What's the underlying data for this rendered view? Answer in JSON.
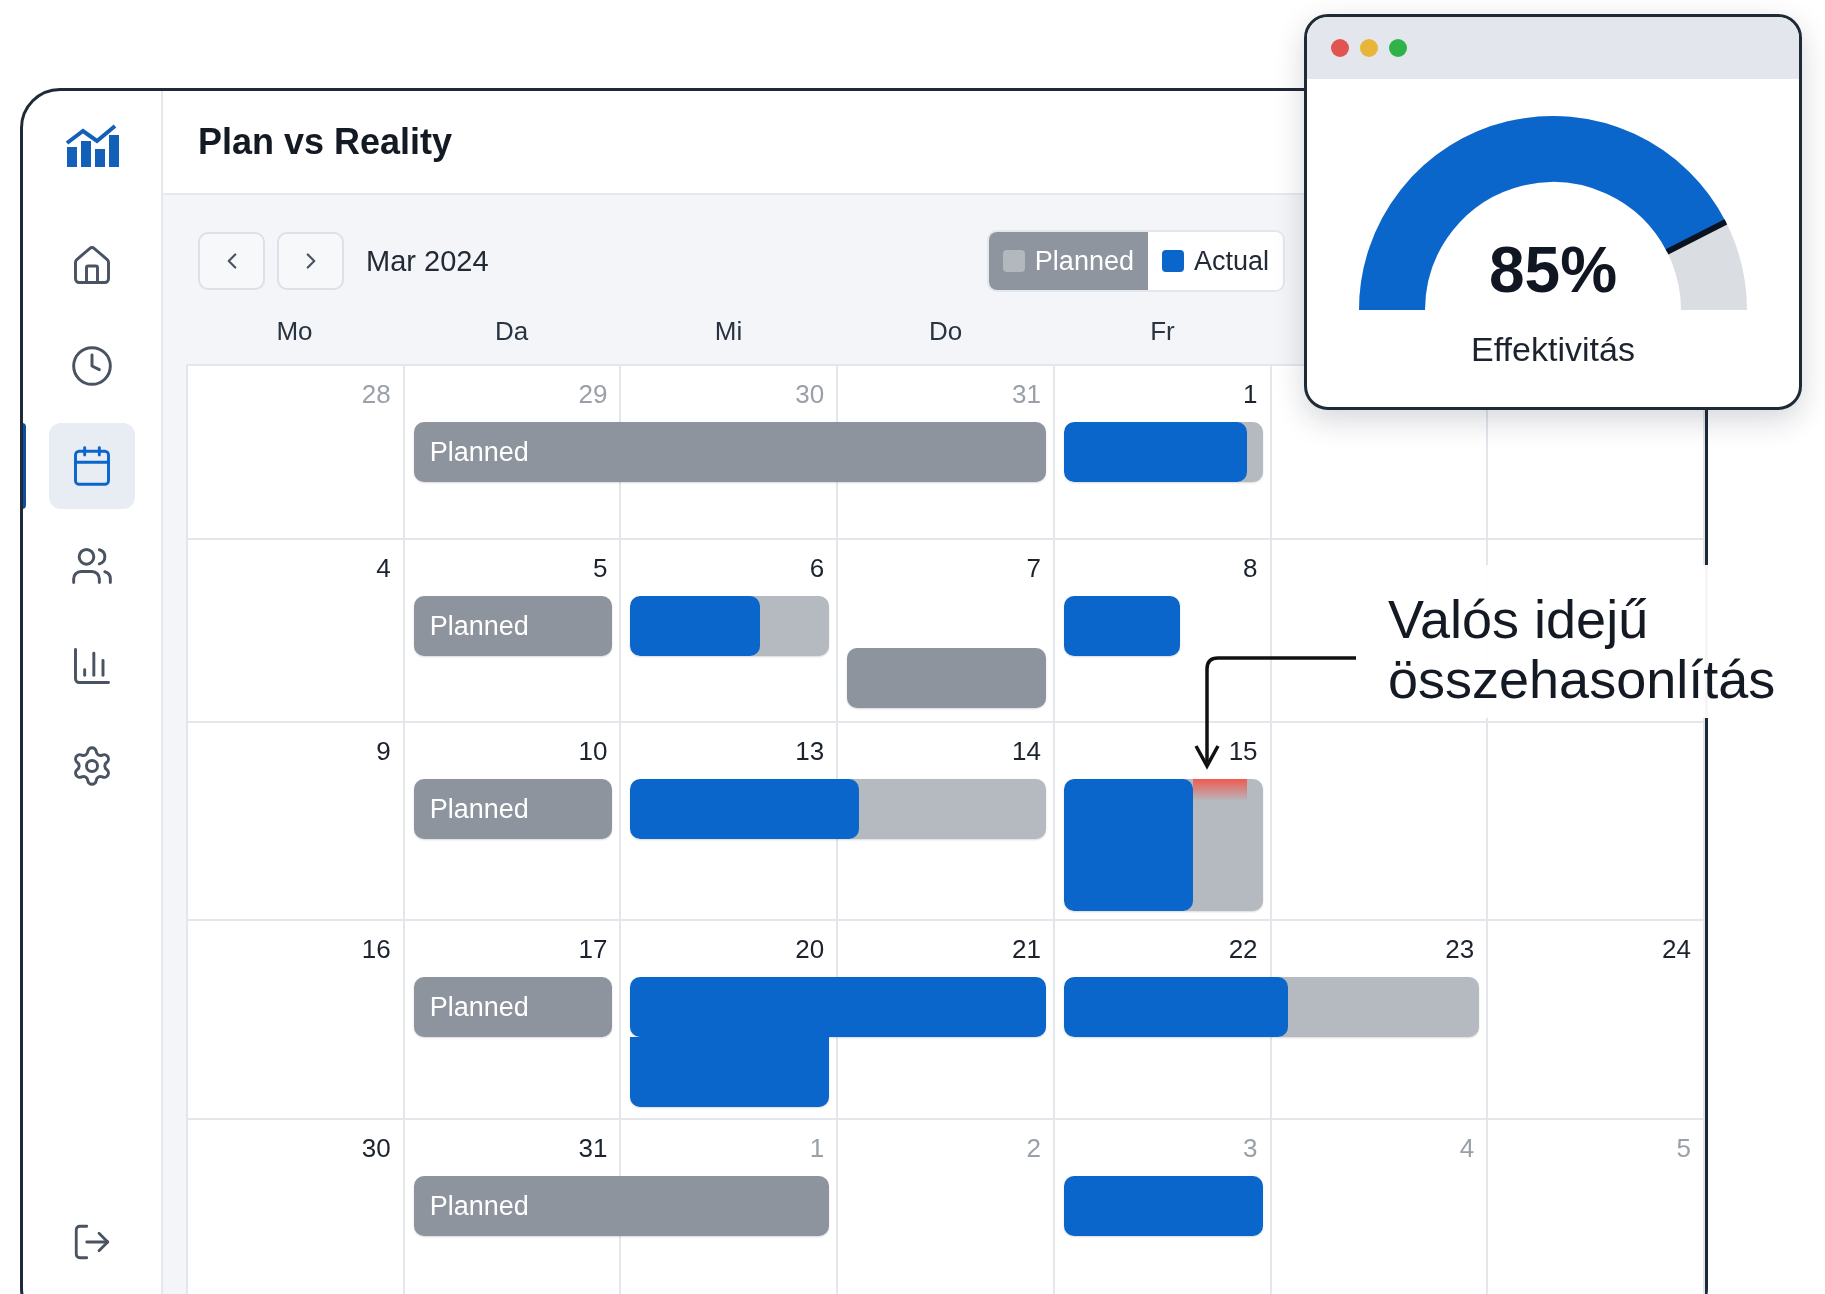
{
  "sidebar": {
    "items": [
      {
        "kind": "home",
        "selected": false
      },
      {
        "kind": "clock",
        "selected": false
      },
      {
        "kind": "calendar",
        "selected": true
      },
      {
        "kind": "users",
        "selected": false
      },
      {
        "kind": "report",
        "selected": false
      },
      {
        "kind": "settings",
        "selected": false
      }
    ]
  },
  "header": {
    "title": "Plan vs Reality"
  },
  "toolbar": {
    "month": "Mar 2024",
    "legend": [
      {
        "kind": "planned",
        "label": "Planned",
        "selected": true
      },
      {
        "kind": "actual",
        "label": "Actual",
        "selected": false
      }
    ]
  },
  "weekdays": [
    "Mo",
    "Da",
    "Mi",
    "Do",
    "Fr"
  ],
  "weeks": [
    {
      "days": [
        {
          "text": "28",
          "muted": true
        },
        {
          "text": "29",
          "muted": true
        },
        {
          "text": "30",
          "muted": true
        },
        {
          "text": "31",
          "muted": true
        },
        {
          "text": "1",
          "muted": false
        }
      ],
      "bars": [
        {
          "kind": "planned",
          "label": "Planned"
        },
        {
          "kind": "progress",
          "level": 0.92
        }
      ]
    },
    {
      "days": [
        {
          "text": "4",
          "muted": false
        },
        {
          "text": "5",
          "muted": false
        },
        {
          "text": "6",
          "muted": false
        },
        {
          "text": "7",
          "muted": false
        },
        {
          "text": "8",
          "muted": false
        }
      ],
      "bars": [
        {
          "kind": "planned",
          "label": "Planned"
        },
        {
          "kind": "progress",
          "level": 0.65
        },
        {
          "kind": "planned"
        },
        {
          "kind": "actual"
        }
      ]
    },
    {
      "days": [
        {
          "text": "9",
          "muted": false
        },
        {
          "text": "10",
          "muted": false
        },
        {
          "text": "13",
          "muted": false
        },
        {
          "text": "14",
          "muted": false
        },
        {
          "text": "15",
          "muted": false
        }
      ],
      "bars": [
        {
          "kind": "planned",
          "label": "Planned"
        },
        {
          "kind": "progress",
          "level": 0.55
        },
        {
          "kind": "progress",
          "level": 0.65,
          "overrun": true
        }
      ]
    },
    {
      "days": [
        {
          "text": "16",
          "muted": false
        },
        {
          "text": "17",
          "muted": false
        },
        {
          "text": "20",
          "muted": false
        },
        {
          "text": "21",
          "muted": false
        },
        {
          "text": "22",
          "muted": false
        },
        {
          "text": "23",
          "muted": false
        },
        {
          "text": "24",
          "muted": false
        }
      ],
      "bars": [
        {
          "kind": "planned",
          "label": "Planned"
        },
        {
          "kind": "actual"
        },
        {
          "kind": "actual"
        },
        {
          "kind": "progress",
          "level": 0.54
        }
      ]
    },
    {
      "days": [
        {
          "text": "30",
          "muted": false
        },
        {
          "text": "31",
          "muted": false
        },
        {
          "text": "1",
          "muted": true
        },
        {
          "text": "2",
          "muted": true
        },
        {
          "text": "3",
          "muted": true
        },
        {
          "text": "4",
          "muted": true
        },
        {
          "text": "5",
          "muted": true
        }
      ],
      "bars": [
        {
          "kind": "planned",
          "label": "Planned"
        },
        {
          "kind": "actual"
        }
      ]
    }
  ],
  "gauge": {
    "level": 0.85,
    "value": "85%",
    "label": "Effektivitás"
  },
  "callout": {
    "text": "Valós idejű összehasonlítás"
  }
}
